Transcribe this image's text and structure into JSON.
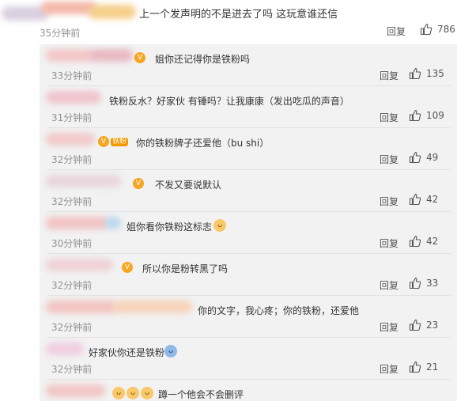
{
  "main_comment": {
    "text": "上一个发声明的不是进去了吗 这玩意谁还信",
    "time": "35分钟前",
    "reply_label": "回复",
    "likes": "786"
  },
  "replies": [
    {
      "text": "姐你还记得你是铁粉吗",
      "time": "33分钟前",
      "reply_label": "回复",
      "likes": "135"
    },
    {
      "text": "铁粉反水？好家伙 有锤吗？让我康康（发出吃瓜的声音）",
      "time": "31分钟前",
      "reply_label": "回复",
      "likes": "109"
    },
    {
      "text": "你的铁粉牌子还爱他（bu shi）",
      "badge": "铁粉",
      "time": "32分钟前",
      "reply_label": "回复",
      "likes": "49"
    },
    {
      "text": "不发又要说默认",
      "time": "32分钟前",
      "reply_label": "回复",
      "likes": "42"
    },
    {
      "text": "姐你看你铁粉这标志",
      "time": "30分钟前",
      "reply_label": "回复",
      "likes": "42"
    },
    {
      "text": "所以你是粉转黑了吗",
      "time": "32分钟前",
      "reply_label": "回复",
      "likes": "33"
    },
    {
      "text": "你的文字，我心疼；你的铁粉，还爱他",
      "time": "32分钟前",
      "reply_label": "回复",
      "likes": "23"
    },
    {
      "text": "好家伙你还是铁粉",
      "time": "32分钟前",
      "reply_label": "回复",
      "likes": "21"
    },
    {
      "text": "蹲一个他会不会删评",
      "time": "",
      "reply_label": "",
      "likes": ""
    }
  ],
  "icons": {
    "like": "thumbs-up-icon",
    "vip": "vip-crown-icon",
    "emoji": "doge-emoji-icon"
  },
  "colors": {
    "panel_bg": "#f2f2f2",
    "meta_text": "#939393",
    "badge": "#f39800"
  }
}
